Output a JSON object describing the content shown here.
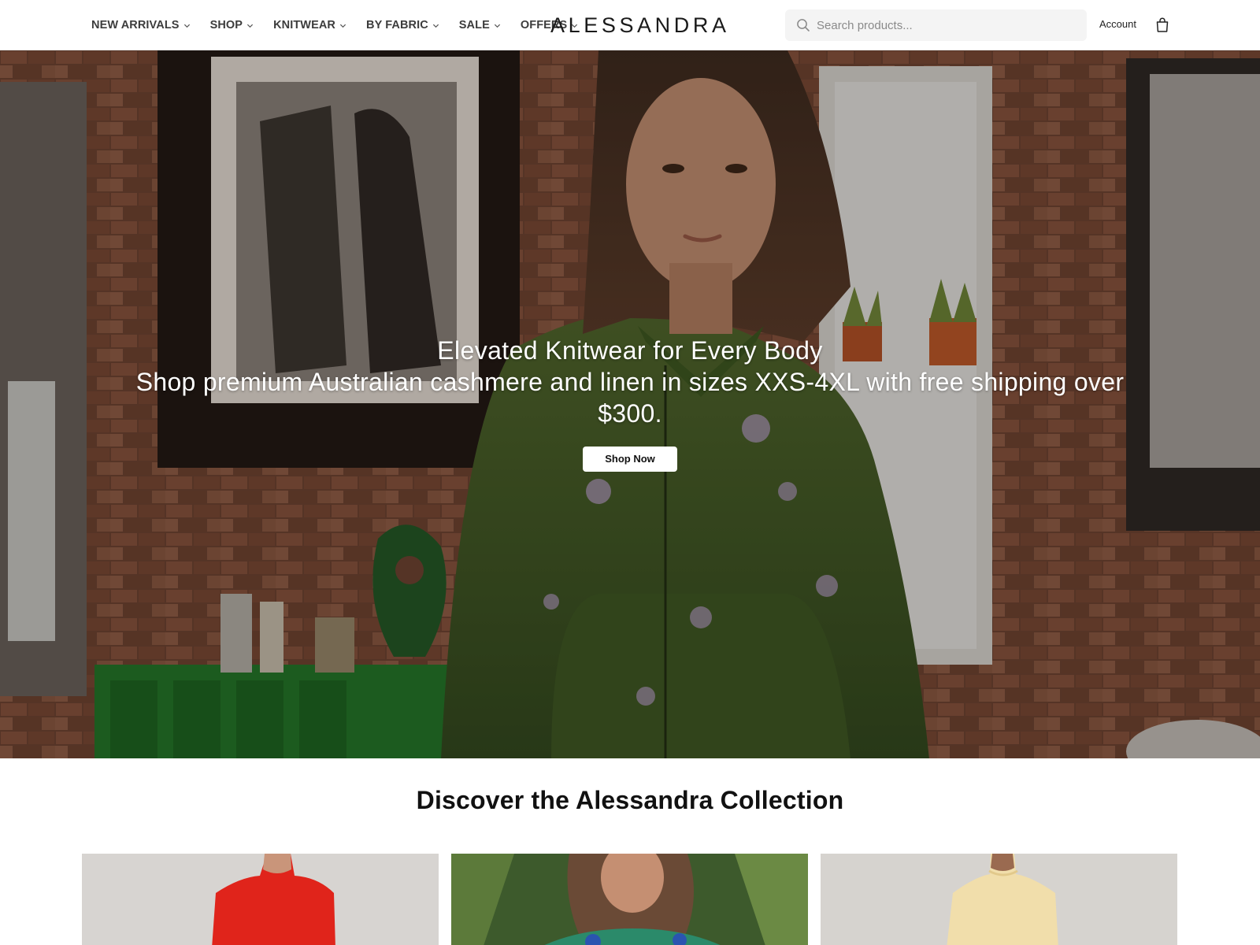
{
  "header": {
    "nav": [
      {
        "label": "NEW ARRIVALS"
      },
      {
        "label": "SHOP"
      },
      {
        "label": "KNITWEAR"
      },
      {
        "label": "BY FABRIC"
      },
      {
        "label": "SALE"
      },
      {
        "label": "OFFERS"
      }
    ],
    "logo": "ALESSANDRA",
    "search": {
      "placeholder": "Search products..."
    },
    "account_label": "Account",
    "icons": {
      "search": "search-icon",
      "cart": "shopping-bag-icon",
      "chevron": "chevron-down-icon"
    }
  },
  "hero": {
    "title": "Elevated Knitwear for Every Body",
    "subtitle": "Shop premium Australian cashmere and linen in sizes XXS-4XL with free shipping over $300.",
    "button_label": "Shop Now"
  },
  "collection": {
    "title": "Discover the Alessandra Collection",
    "cards": [
      {
        "image": "red-knit-top"
      },
      {
        "image": "floral-top-garden"
      },
      {
        "image": "cream-knit-top"
      }
    ]
  },
  "colors": {
    "accent": "#111111",
    "hero_overlay": "#140a05"
  }
}
